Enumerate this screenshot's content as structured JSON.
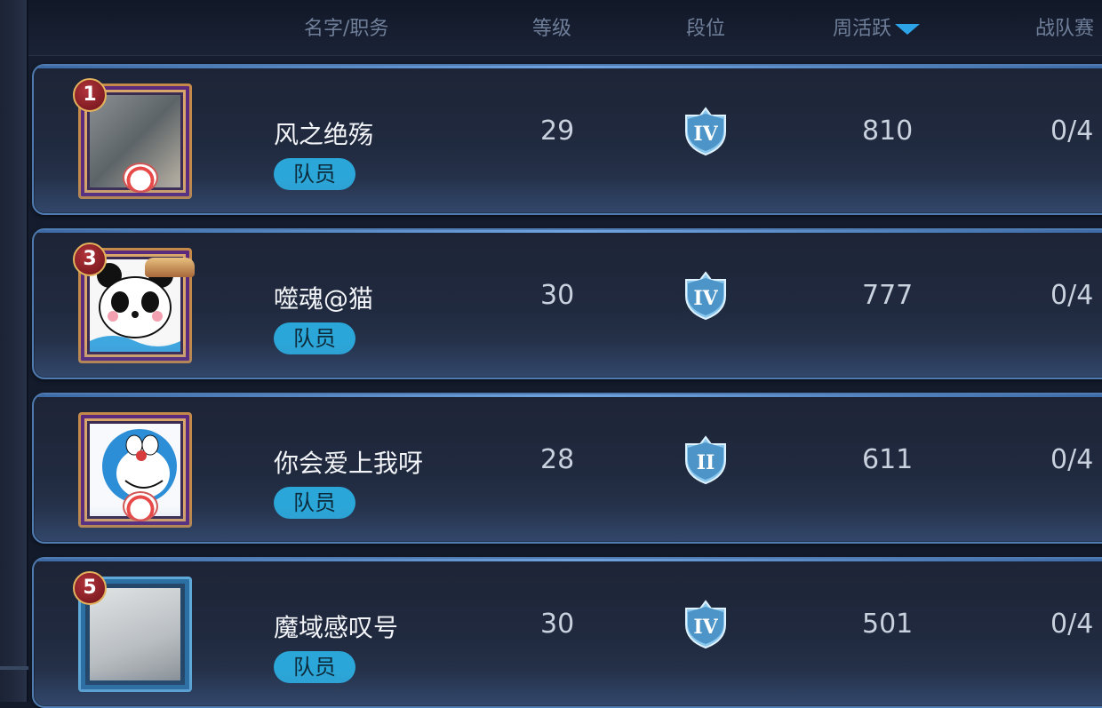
{
  "header": {
    "col_name": "名字/职务",
    "col_level": "等级",
    "col_tier": "段位",
    "col_activity": "周活跃",
    "col_match": "战队赛"
  },
  "members": [
    {
      "rank": "1",
      "name": "风之绝殇",
      "role": "队员",
      "level": "29",
      "tier": "IV",
      "activity": "810",
      "match": "0/4"
    },
    {
      "rank": "3",
      "name": "噬魂@猫",
      "role": "队员",
      "level": "30",
      "tier": "IV",
      "activity": "777",
      "match": "0/4"
    },
    {
      "rank": "",
      "name": "你会爱上我呀",
      "role": "队员",
      "level": "28",
      "tier": "II",
      "activity": "611",
      "match": "0/4"
    },
    {
      "rank": "5",
      "name": "魔域感叹号",
      "role": "队员",
      "level": "30",
      "tier": "IV",
      "activity": "501",
      "match": "0/4"
    }
  ],
  "colors": {
    "accent": "#2ea4e8",
    "role_pill": "#2ba6d8",
    "row_border": "#4f7bb0"
  },
  "icons": {
    "sort": "sort-desc-icon",
    "tier": "tier-shield-icon"
  }
}
